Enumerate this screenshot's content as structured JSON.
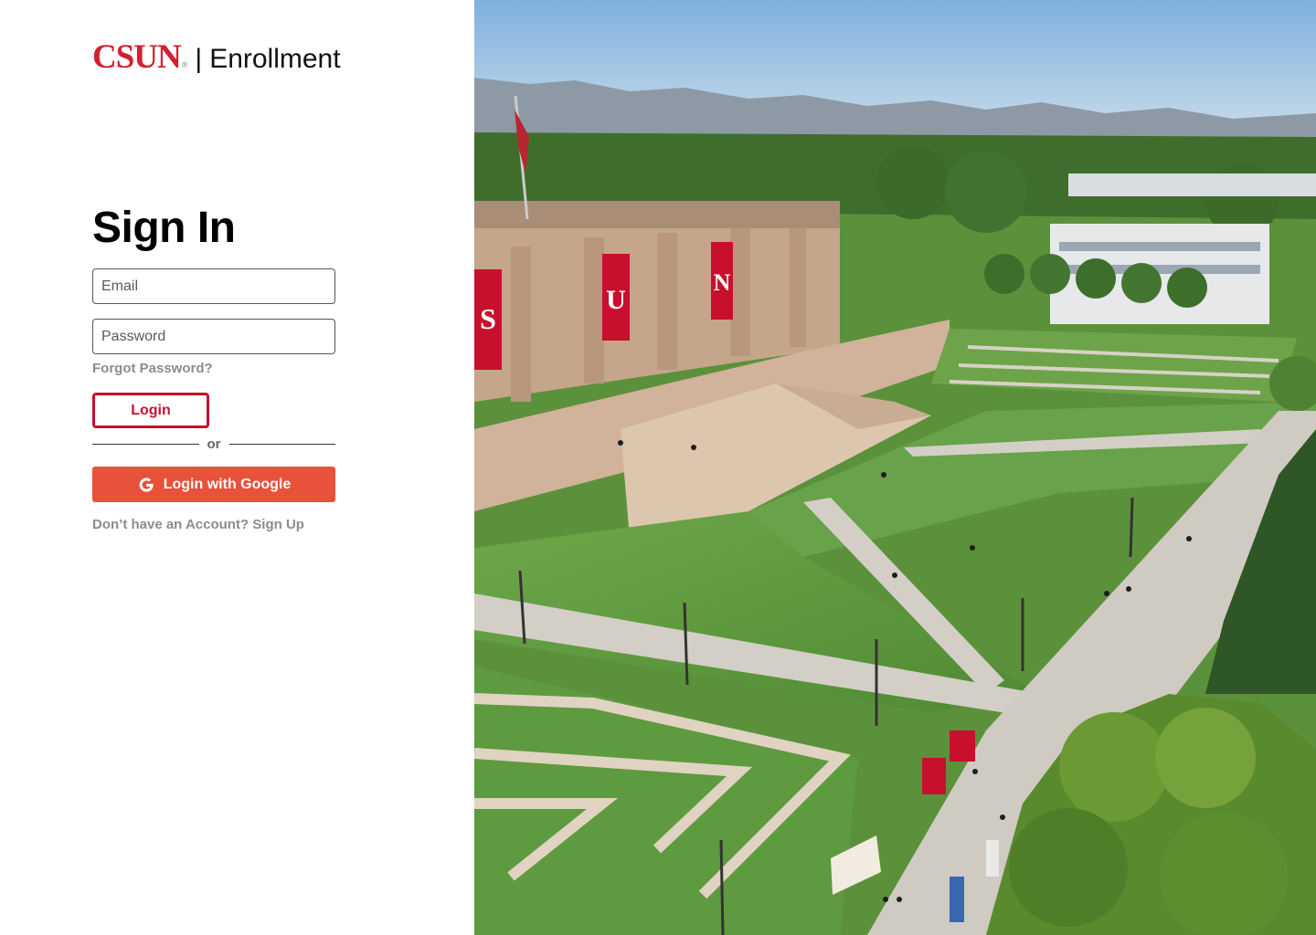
{
  "brand": {
    "logo": "CSUN",
    "registered": "®",
    "separator": "|",
    "app_name": "Enrollment",
    "logo_color": "#d22030"
  },
  "signin": {
    "title": "Sign In",
    "email_placeholder": "Email",
    "password_placeholder": "Password",
    "forgot_label": "Forgot Password?",
    "login_label": "Login",
    "divider_label": "or",
    "google_label": "Login with Google",
    "signup_label": "Don’t have an Account? Sign Up",
    "login_color": "#c8102e",
    "google_color": "#e8513a"
  },
  "hero": {
    "banner_letters": [
      "S",
      "U",
      "N"
    ],
    "banner_color": "#c8102e"
  }
}
